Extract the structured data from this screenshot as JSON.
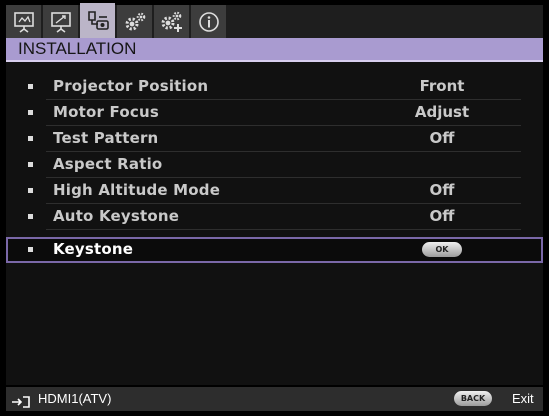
{
  "tabs": [
    {
      "icon": "display-picture-icon",
      "active": false
    },
    {
      "icon": "display-advanced-icon",
      "active": false
    },
    {
      "icon": "installation-icon",
      "active": true
    },
    {
      "icon": "system-setup-icon",
      "active": false
    },
    {
      "icon": "system-advanced-icon",
      "active": false
    },
    {
      "icon": "information-icon",
      "active": false
    }
  ],
  "title": "INSTALLATION",
  "menu": {
    "items": [
      {
        "label": "Projector Position",
        "value": "Front"
      },
      {
        "label": "Motor Focus",
        "value": "Adjust"
      },
      {
        "label": "Test Pattern",
        "value": "Off"
      },
      {
        "label": "Aspect Ratio",
        "value": ""
      },
      {
        "label": "High Altitude Mode",
        "value": "Off"
      },
      {
        "label": "Auto Keystone",
        "value": "Off"
      },
      {
        "label": "Keystone",
        "value": "OK",
        "selected": true
      }
    ]
  },
  "status": {
    "source": "HDMI1(ATV)",
    "back_button": "BACK",
    "exit_label": "Exit"
  },
  "colors": {
    "accent": "#a99bd0",
    "selection_outline": "#7a68a8",
    "background": "#000000"
  }
}
